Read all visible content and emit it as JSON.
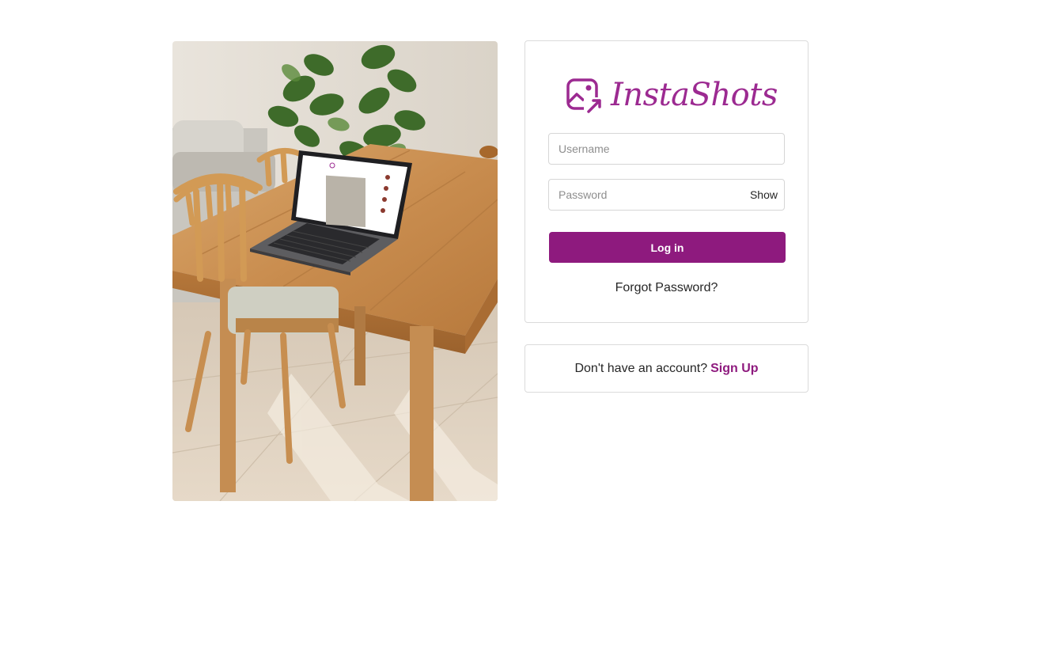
{
  "brand": {
    "name": "InstaShots",
    "icon": "image-share-icon",
    "color": "#9c2a91"
  },
  "login_form": {
    "username_placeholder": "Username",
    "password_placeholder": "Password",
    "show_label": "Show",
    "login_button": "Log in",
    "forgot_password": "Forgot Password?",
    "button_color": "#8e1a7e"
  },
  "signup": {
    "prompt": "Don't have an account?",
    "link": "Sign Up"
  },
  "hero_image": {
    "icon": "laptop-on-table-photo"
  }
}
